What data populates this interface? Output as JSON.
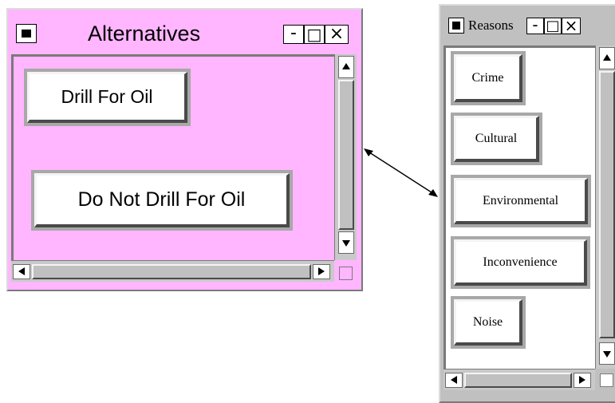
{
  "alternatives_window": {
    "title": "Alternatives",
    "bg_color": "#ffb6ff",
    "menu_icon": "window-menu-icon",
    "minimize_glyph": "-",
    "maximize_glyph": "□",
    "close_glyph": "×",
    "buttons": [
      {
        "label": "Drill For Oil"
      },
      {
        "label": "Do Not Drill For Oil"
      }
    ]
  },
  "reasons_window": {
    "title": "Reasons",
    "bg_color": "#ffffff",
    "menu_icon": "window-menu-icon",
    "minimize_glyph": "-",
    "maximize_glyph": "□",
    "close_glyph": "×",
    "buttons": [
      {
        "label": "Crime"
      },
      {
        "label": "Cultural"
      },
      {
        "label": "Environmental"
      },
      {
        "label": "Inconvenience"
      },
      {
        "label": "Noise"
      }
    ]
  },
  "link_arrow": {
    "icon": "double-headed-arrow-icon",
    "color": "#000000"
  }
}
